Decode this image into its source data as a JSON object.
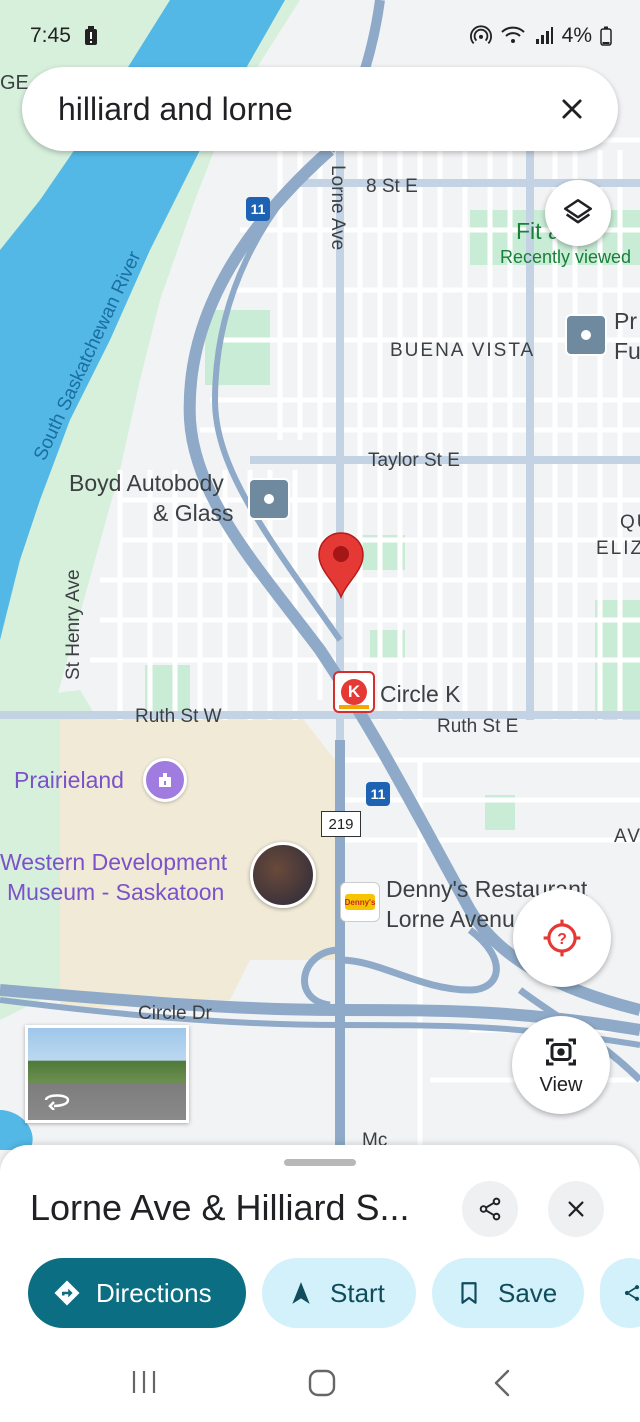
{
  "status_bar": {
    "time": "7:45",
    "battery": "4%"
  },
  "search": {
    "query": "hilliard and lorne"
  },
  "map": {
    "edge_label_top": "GE",
    "streets": {
      "eighth": "8 St E",
      "lorne": "Lorne Ave",
      "taylor": "Taylor St E",
      "ruth_w": "Ruth St W",
      "ruth_e": "Ruth St E",
      "st_henry": "St Henry Ave",
      "circle_dr": "Circle Dr",
      "bottom_partial": "Mc"
    },
    "river": "South Saskatchewan River",
    "neighbourhood": "BUENA VISTA",
    "edge_labels": {
      "qu": "QU",
      "eliz": "ELIZ",
      "av": "AV"
    },
    "highway_shields": {
      "hwy11_top": "11",
      "hwy11_bottom": "11",
      "hwy219": "219"
    },
    "pois": {
      "fitz_line1": "Fit   arla",
      "fitz_line2": "Recently viewed",
      "boyd_line1": "Boyd Autobody",
      "boyd_line2": "& Glass",
      "pr_line1": "Pr",
      "pr_line2": "Fu",
      "circlek": "Circle K",
      "prairieland": "Prairieland",
      "wdm_line1": "Western Development",
      "wdm_line2": "Museum - Saskatoon",
      "dennys_line1": "Denny's Restaurant",
      "dennys_line2": "Lorne Avenu",
      "dennys_logo": "Denny's"
    },
    "view_label": "View"
  },
  "sheet": {
    "title": "Lorne Ave & Hilliard S...",
    "buttons": {
      "directions": "Directions",
      "start": "Start",
      "save": "Save"
    }
  },
  "colors": {
    "accent": "#0b6e82",
    "chip_light": "#d3f1fa",
    "pin": "#e53935",
    "water": "#4fb7e8",
    "park": "#c8ecd6"
  }
}
